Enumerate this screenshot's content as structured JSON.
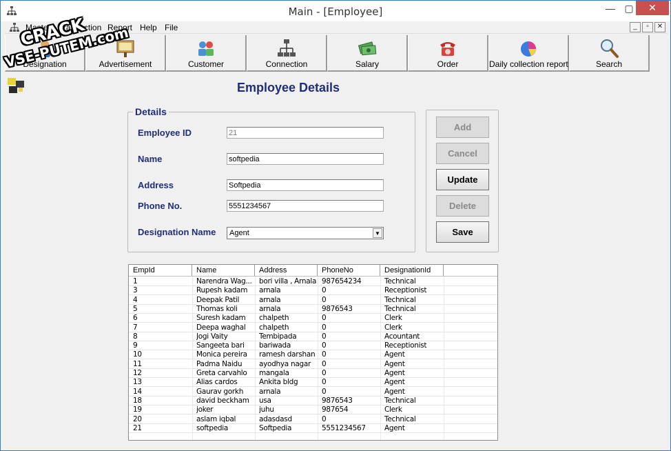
{
  "window": {
    "title": "Main - [Employee]",
    "icon": "network-tree-icon"
  },
  "window_controls": {
    "minimize": "—",
    "maximize": "▢",
    "close": "✕"
  },
  "menubar": {
    "items": [
      "Master",
      "Transaction",
      "Report",
      "Help",
      "File"
    ],
    "mdi_controls": [
      "_",
      "▫",
      "✕"
    ]
  },
  "toolbar": {
    "items": [
      {
        "label": "Designation",
        "icon": "person-icon"
      },
      {
        "label": "Advertisement",
        "icon": "billboard-icon"
      },
      {
        "label": "Customer",
        "icon": "customer-group-icon"
      },
      {
        "label": "Connection",
        "icon": "network-tree-icon"
      },
      {
        "label": "Salary",
        "icon": "money-icon"
      },
      {
        "label": "Order",
        "icon": "telephone-icon"
      },
      {
        "label": "Daily collection report",
        "icon": "pie-chart-icon"
      },
      {
        "label": "Search",
        "icon": "magnifier-icon"
      }
    ]
  },
  "page": {
    "title": "Employee Details"
  },
  "details": {
    "legend": "Details",
    "employee_id": {
      "label": "Employee ID",
      "value": "21"
    },
    "name": {
      "label": "Name",
      "value": "softpedia"
    },
    "address": {
      "label": "Address",
      "value": "Softpedia"
    },
    "phone": {
      "label": "Phone No.",
      "value": "5551234567"
    },
    "designation": {
      "label": "Designation Name",
      "value": "Agent"
    }
  },
  "actions": {
    "add": "Add",
    "cancel": "Cancel",
    "update": "Update",
    "delete": "Delete",
    "save": "Save"
  },
  "grid": {
    "columns": [
      "EmpId",
      "Name",
      "Address",
      "PhoneNo",
      "DesignationId"
    ],
    "rows": [
      [
        "1",
        "Narendra Wag...",
        "bori villa , Arnala",
        "987654234",
        "Technical"
      ],
      [
        "3",
        "Rupesh kadam",
        "arnala",
        "0",
        "Receptionist"
      ],
      [
        "4",
        "Deepak Patil",
        "arnala",
        "0",
        "Technical"
      ],
      [
        "5",
        "Thomas koli",
        "arnala",
        "9876543",
        "Technical"
      ],
      [
        "6",
        "Suresh kadam",
        "chalpeth",
        "0",
        "Clerk"
      ],
      [
        "7",
        "Deepa waghal",
        "chalpeth",
        "0",
        "Clerk"
      ],
      [
        "8",
        "Jogi Vaity",
        "Tembipada",
        "0",
        "Acountant"
      ],
      [
        "9",
        "Sangeeta bari",
        "bariwada",
        "0",
        "Receptionist"
      ],
      [
        "10",
        "Monica pereira",
        "ramesh darshan",
        "0",
        "Agent"
      ],
      [
        "11",
        "Padma Naidu",
        "ayodhya nagar",
        "0",
        "Agent"
      ],
      [
        "12",
        "Greta carvahlo",
        "mangala",
        "0",
        "Agent"
      ],
      [
        "13",
        "Alias cardos",
        "Ankita bldg",
        "0",
        "Agent"
      ],
      [
        "14",
        "Gaurav gorkh",
        "arnala",
        "0",
        "Agent"
      ],
      [
        "18",
        "david beckham",
        "usa",
        "9876543",
        "Technical"
      ],
      [
        "19",
        "joker",
        "juhu",
        "987654",
        "Clerk"
      ],
      [
        "20",
        "aslam iqbal",
        "adasdasd",
        "0",
        "Technical"
      ],
      [
        "21",
        "softpedia",
        "Softpedia",
        "5551234567",
        "Agent"
      ]
    ]
  },
  "watermark": {
    "line1": "CRACK",
    "line2": "VSE-PUTEM.com"
  },
  "colors": {
    "label_navy": "#1f2d7a",
    "close_red": "#c75050"
  }
}
